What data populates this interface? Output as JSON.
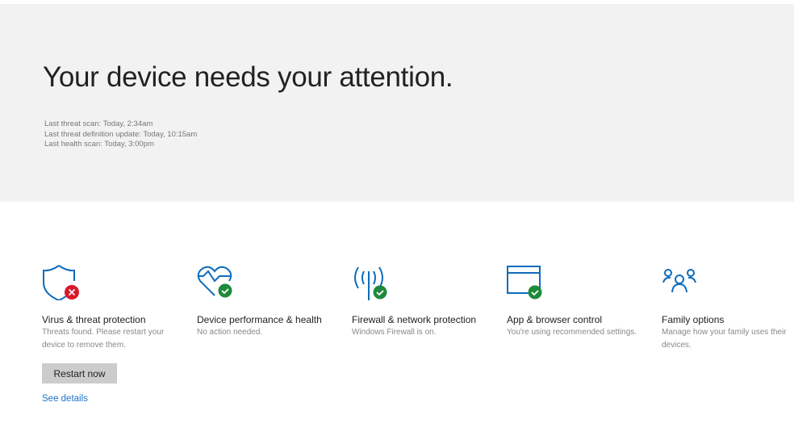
{
  "header": {
    "title": "Your device needs your attention.",
    "scans": [
      "Last threat scan: Today, 2:34am",
      "Last threat definition update: Today, 10:15am",
      "Last health scan: Today, 3:00pm"
    ]
  },
  "cards": [
    {
      "title": "Virus & threat protection",
      "desc": "Threats found. Please restart your device to remove them.",
      "icon": "shield-icon",
      "status": "error"
    },
    {
      "title": "Device performance & health",
      "desc": "No action needed.",
      "icon": "heart-pulse-icon",
      "status": "ok"
    },
    {
      "title": "Firewall & network protection",
      "desc": "Windows Firewall is on.",
      "icon": "antenna-icon",
      "status": "ok"
    },
    {
      "title": "App & browser control",
      "desc": "You're using recommended settings.",
      "icon": "browser-window-icon",
      "status": "ok"
    },
    {
      "title": "Family options",
      "desc": "Manage how your family uses their devices.",
      "icon": "family-icon"
    }
  ],
  "actions": {
    "restart": "Restart now",
    "details": "See details"
  },
  "colors": {
    "accent": "#0f6cbd",
    "ok": "#1e8a3c",
    "error": "#d9192b"
  }
}
